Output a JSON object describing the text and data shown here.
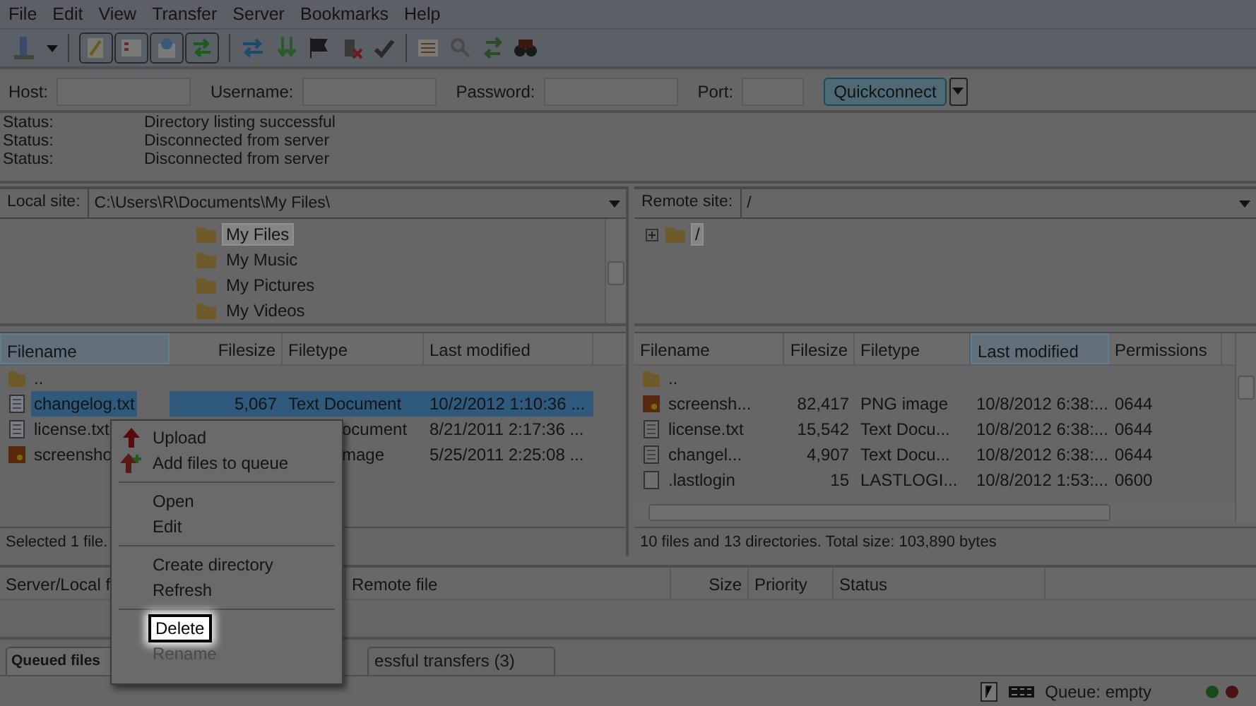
{
  "menu_bar": [
    "File",
    "Edit",
    "View",
    "Transfer",
    "Server",
    "Bookmarks",
    "Help"
  ],
  "toolbar": {
    "toggles": [
      {
        "pressed": true
      },
      {
        "pressed": true
      },
      {
        "pressed": true
      },
      {
        "pressed": true
      }
    ]
  },
  "quickconnect": {
    "host_label": "Host:",
    "username_label": "Username:",
    "password_label": "Password:",
    "port_label": "Port:",
    "button": "Quickconnect"
  },
  "message_log": [
    {
      "label": "Status:",
      "text": "Directory listing successful"
    },
    {
      "label": "Status:",
      "text": "Disconnected from server"
    },
    {
      "label": "Status:",
      "text": "Disconnected from server"
    }
  ],
  "local_site": {
    "label": "Local site:",
    "path": "C:\\Users\\R\\Documents\\My Files\\",
    "tree": [
      {
        "name": "My Files",
        "selected": true
      },
      {
        "name": "My Music",
        "selected": false
      },
      {
        "name": "My Pictures",
        "selected": false
      },
      {
        "name": "My Videos",
        "selected": false
      }
    ]
  },
  "remote_site": {
    "label": "Remote site:",
    "path": "/",
    "tree": [
      {
        "name": "/",
        "selected": true
      }
    ]
  },
  "local_files": {
    "columns": [
      "Filename",
      "Filesize",
      "Filetype",
      "Last modified"
    ],
    "rows": [
      {
        "kind": "folder",
        "name": "..",
        "selected": false
      },
      {
        "kind": "text",
        "name": "changelog.txt",
        "size": "5,067",
        "type": "Text Document",
        "modified": "10/2/2012 1:10:36 ...",
        "selected": true
      },
      {
        "kind": "text",
        "name": "license.txt",
        "type": "ocument",
        "modified": "8/21/2011 2:17:36 ...",
        "selected": false
      },
      {
        "kind": "image",
        "name": "screensho",
        "type": "mage",
        "modified": "5/25/2011 2:25:08 ...",
        "selected": false
      }
    ],
    "status": "Selected 1 file."
  },
  "remote_files": {
    "columns": [
      "Filename",
      "Filesize",
      "Filetype",
      "Last modified",
      "Permissions"
    ],
    "rows": [
      {
        "kind": "folder",
        "name": "..",
        "selected": false
      },
      {
        "kind": "image",
        "name": "screensh...",
        "size": "82,417",
        "type": "PNG image",
        "modified": "10/8/2012 6:38:...",
        "perm": "0644",
        "selected": false
      },
      {
        "kind": "text",
        "name": "license.txt",
        "size": "15,542",
        "type": "Text Docu...",
        "modified": "10/8/2012 6:38:...",
        "perm": "0644",
        "selected": false
      },
      {
        "kind": "text",
        "name": "changel...",
        "size": "4,907",
        "type": "Text Docu...",
        "modified": "10/8/2012 6:38:...",
        "perm": "0644",
        "selected": false
      },
      {
        "kind": "blank",
        "name": ".lastlogin",
        "size": "15",
        "type": "LASTLOGI...",
        "modified": "10/8/2012 1:53:...",
        "perm": "0600",
        "selected": false
      }
    ],
    "status": "10 files and 13 directories. Total size: 103,890 bytes"
  },
  "queue": {
    "columns": [
      "Server/Local f",
      "Remote file",
      "Size",
      "Priority",
      "Status"
    ],
    "tabs": [
      {
        "label": "Queued files",
        "selected": true
      },
      {
        "label": "essful transfers (3)",
        "selected": false
      }
    ]
  },
  "context_menu": [
    {
      "kind": "item",
      "label": "Upload",
      "selected": false,
      "disabled": false
    },
    {
      "kind": "item",
      "label": "Add files to queue",
      "selected": false,
      "disabled": false
    },
    {
      "kind": "separator"
    },
    {
      "kind": "item",
      "label": "Open",
      "selected": false,
      "disabled": false
    },
    {
      "kind": "item",
      "label": "Edit",
      "selected": false,
      "disabled": false
    },
    {
      "kind": "separator"
    },
    {
      "kind": "item",
      "label": "Create directory",
      "selected": false,
      "disabled": false
    },
    {
      "kind": "item",
      "label": "Refresh",
      "selected": false,
      "disabled": false
    },
    {
      "kind": "separator"
    },
    {
      "kind": "item",
      "label": "Delete",
      "selected": true,
      "disabled": false
    },
    {
      "kind": "item",
      "label": "Rename",
      "selected": false,
      "disabled": true
    }
  ],
  "status_bar": {
    "queue": "Queue: empty"
  }
}
